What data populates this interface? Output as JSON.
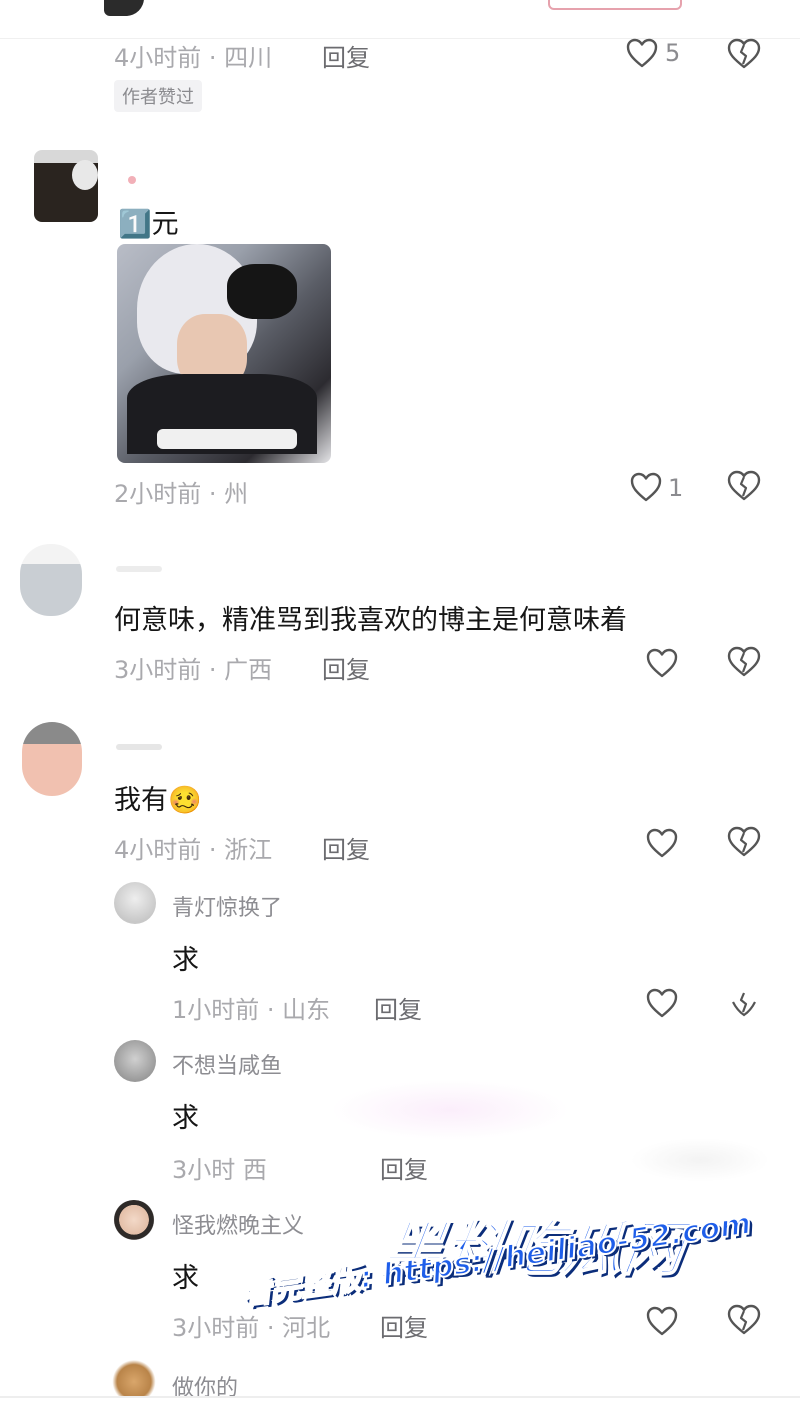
{
  "comments": [
    {
      "time": "4小时前 · 四川",
      "reply_label": "回复",
      "likes": "5",
      "badge": "作者赞过"
    },
    {
      "text": "1️⃣元",
      "time": "2小时前 · 州",
      "likes": "1"
    },
    {
      "text": "何意味，精准骂到我喜欢的博主是何意味着",
      "time": "3小时前 · 广西",
      "reply_label": "回复"
    },
    {
      "text": "我有🥴",
      "time": "4小时前 · 浙江",
      "reply_label": "回复",
      "replies": [
        {
          "name": "青灯惊换了",
          "text": "求",
          "time": "1小时前 · 山东",
          "reply_label": "回复"
        },
        {
          "name": "不想当咸鱼",
          "text": "求",
          "time": "3小时 西",
          "reply_label": "回复"
        },
        {
          "name": "怪我燃晚主义",
          "text": "求",
          "time": "3小时前 · 河北",
          "reply_label": "回复"
        },
        {
          "name": "做你的"
        }
      ]
    }
  ],
  "watermark": {
    "title": "黑料吃瓜网",
    "subtitle": "看完整版: https://heiliao-52.com"
  },
  "colors": {
    "watermark_blue": "#1e5eea",
    "meta_gray": "#a9a9ad"
  },
  "icons": [
    "heart-icon",
    "broken-heart-icon"
  ]
}
